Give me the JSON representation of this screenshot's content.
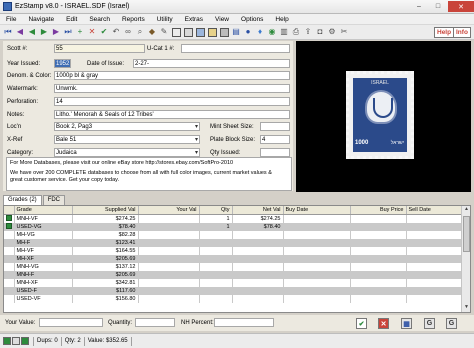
{
  "window": {
    "title": "EzStamp v8.0 - ISRAEL.SDF (Israel)"
  },
  "window_controls": {
    "minimize": "–",
    "maximize": "□",
    "close": "✕"
  },
  "menu": [
    "File",
    "Navigate",
    "Edit",
    "Search",
    "Reports",
    "Utility",
    "Extras",
    "View",
    "Options",
    "Help"
  ],
  "toolbar": {
    "help_label": "Help",
    "info_label": "Info"
  },
  "form": {
    "scott_label": "Scott #:",
    "scott_value": "55",
    "ucat_label": "U-Cat 1 #:",
    "ucat_value": "",
    "year_label": "Year Issued:",
    "year_value": "1952",
    "date_label": "Date of Issue:",
    "date_value": "2-27-",
    "denom_label": "Denom. & Color:",
    "denom_value": "1000p bl & gray",
    "watermark_label": "Watermark:",
    "watermark_value": "Unwmk.",
    "perf_label": "Perforation:",
    "perf_value": "14",
    "notes_label": "Notes:",
    "notes_value": "Litho.' Menorah & Seals of 12 Tribes'",
    "loc_label": "Loc'n",
    "loc_value": "Book 2, Pag3",
    "mint_label": "Mint Sheet Size:",
    "mint_value": "",
    "xref_label": "X-Ref",
    "xref_value": "Bale 51",
    "plate_label": "Plate Block Size:",
    "plate_value": "4",
    "category_label": "Category:",
    "category_value": "Judaica",
    "qty_label": "Qty Issued:",
    "qty_value": ""
  },
  "database_text": {
    "line1": "For More Databases, please visit our online eBay store   http://stores.ebay.com/SoftPro-2010",
    "line2": "We have over 200 COMPLETE databases to choose from all with full color images, current market values &",
    "line3": "great customer service. Get your copy today."
  },
  "stamp": {
    "country": "ISRAEL",
    "value": "1000",
    "hebrew": "ישראל"
  },
  "tabs": [
    {
      "label": "Grades (2)",
      "active": true
    },
    {
      "label": "FDC",
      "active": false
    }
  ],
  "grid": {
    "headers": [
      "",
      "Grade",
      "Supplied Val",
      "Your Val",
      "Qty",
      "Net Val",
      "Buy Date",
      "Buy Price",
      "Sell Date"
    ],
    "rows": [
      {
        "checked": true,
        "grade": "MNH-VF",
        "supplied": "$274.25",
        "your": "",
        "qty": "1",
        "net": "$274.25"
      },
      {
        "checked": true,
        "grade": "USED-VG",
        "supplied": "$78.40",
        "your": "",
        "qty": "1",
        "net": "$78.40"
      },
      {
        "checked": false,
        "grade": "MH-VG",
        "supplied": "$82.28",
        "your": "",
        "qty": "",
        "net": ""
      },
      {
        "checked": false,
        "grade": "MH-F",
        "supplied": "$123.41",
        "your": "",
        "qty": "",
        "net": ""
      },
      {
        "checked": false,
        "grade": "MH-VF",
        "supplied": "$164.55",
        "your": "",
        "qty": "",
        "net": ""
      },
      {
        "checked": false,
        "grade": "MH-XF",
        "supplied": "$205.69",
        "your": "",
        "qty": "",
        "net": ""
      },
      {
        "checked": false,
        "grade": "MNH-VG",
        "supplied": "$137.12",
        "your": "",
        "qty": "",
        "net": ""
      },
      {
        "checked": false,
        "grade": "MNH-F",
        "supplied": "$205.69",
        "your": "",
        "qty": "",
        "net": ""
      },
      {
        "checked": false,
        "grade": "MNH-XF",
        "supplied": "$342.81",
        "your": "",
        "qty": "",
        "net": ""
      },
      {
        "checked": false,
        "grade": "USED-F",
        "supplied": "$117.60",
        "your": "",
        "qty": "",
        "net": ""
      },
      {
        "checked": false,
        "grade": "USED-VF",
        "supplied": "$156.80",
        "your": "",
        "qty": "",
        "net": ""
      }
    ]
  },
  "bottom": {
    "your_value_label": "Your Value:",
    "quantity_label": "Quantity:",
    "nh_label": "NH Percent:"
  },
  "status": {
    "dups": "Dups: 0",
    "qty": "Qty: 2",
    "value": "Value: $352.65"
  },
  "colors": {
    "accent": "#3f6db3",
    "row_alt": "#c9c9c9",
    "close_red": "#c9443a"
  }
}
